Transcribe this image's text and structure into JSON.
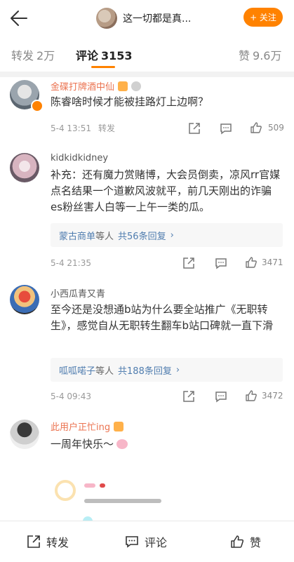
{
  "header": {
    "title": "这一切都是真...",
    "follow_label": "+ 关注"
  },
  "tabs": [
    {
      "label": "转发",
      "count": "2万"
    },
    {
      "label": "评论",
      "count": "3153"
    },
    {
      "label": "赞",
      "count": "9.6万"
    }
  ],
  "comments": [
    {
      "name": "金碟打牌酒中仙",
      "text": "陈睿啥时候才能被挂路灯上边啊？",
      "time": "5-4 13:51",
      "forward": "转发",
      "likes": "509"
    },
    {
      "name": "kidkidkidney",
      "text": "补充：还有魔力赏赌博，大会员倒卖，凉风rr官媒点名结果一个道歉风波就平，前几天刚出的诈骗es粉丝害人白等一上午一类的瓜。",
      "replies_user": "蒙古商单",
      "replies_mid": "等人",
      "replies_total": "共56条回复",
      "time": "5-4 21:35",
      "likes": "3471"
    },
    {
      "name": "小西瓜青又青",
      "text": "至今还是没想通b站为什么要全站推广《无职转生》，感觉自从无职转生翻车b站口碑就一直下滑",
      "replies_user": "呱呱喏子",
      "replies_mid": "等人",
      "replies_total": "共188条回复",
      "time": "5-4 09:43",
      "likes": "3472"
    },
    {
      "name": "此用户正忙ing",
      "text": "一周年快乐～"
    }
  ],
  "bottom": {
    "forward": "转发",
    "comment": "评论",
    "like": "赞"
  },
  "colors": {
    "accent": "#ff8200",
    "link": "#507daf",
    "vip_name": "#eb7350"
  }
}
